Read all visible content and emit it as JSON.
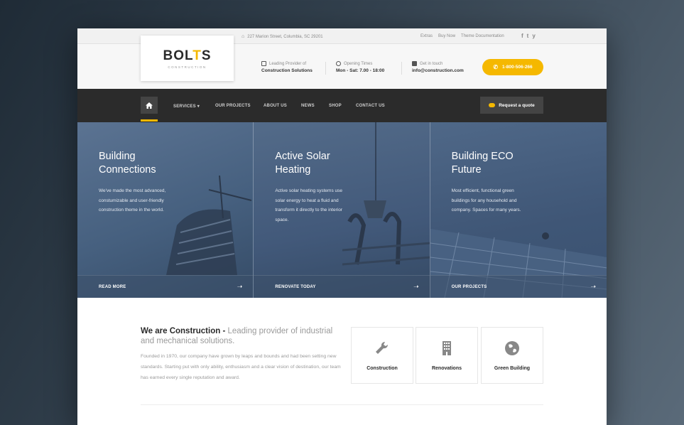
{
  "topbar": {
    "address": "227 Marion Street, Columbia, SC 29201",
    "links": [
      "Extras",
      "Buy Now",
      "Theme Documentation"
    ],
    "social": {
      "facebook": "f",
      "twitter": "t",
      "youtube": "y"
    }
  },
  "header": {
    "logo_main_start": "BOL",
    "logo_main_accent": "T",
    "logo_main_end": "S",
    "logo_sub": "CONSTRUCTION",
    "info1_label": "Leading Provider of",
    "info1_value": "Construction Solutions",
    "info2_label": "Opening Times",
    "info2_value": "Mon - Sat: 7.00 - 18:00",
    "info3_label": "Get in touch",
    "info3_value": "info@construction.com",
    "phone": "1-800-506-266"
  },
  "nav": {
    "items": [
      "SERVICES ▾",
      "OUR PROJECTS",
      "ABOUT US",
      "NEWS",
      "SHOP",
      "CONTACT US"
    ],
    "quote": "Request a quote"
  },
  "hero": [
    {
      "title": "Building Connections",
      "text": "We've made the most advanced, constumizable and user-friendly construction theme in the world.",
      "link": "READ MORE"
    },
    {
      "title": "Active Solar Heating",
      "text": "Active solar heating systems use solar energy to heat a fluid and transform it directly to the interior space.",
      "link": "RENOVATE TODAY"
    },
    {
      "title": "Building ECO Future",
      "text": "Most efficient, functional green buildings for any household and company. Spaces for many years.",
      "link": "OUR PROJECTS"
    }
  ],
  "about": {
    "heading_bold": "We are Construction - ",
    "heading_light": "Leading provider of industrial and mechanical solutions.",
    "text": "Founded in 1970, our company have grown by leaps and bounds and had been setting new standards. Starting put with only ability, enthusiasm and a clear vision of destination, our team has earned every single reputation and award."
  },
  "services": [
    "Construction",
    "Renovations",
    "Green Building"
  ],
  "colors": {
    "accent": "#f5b800",
    "nav": "#2b2b2b",
    "hero": "#46607f"
  }
}
